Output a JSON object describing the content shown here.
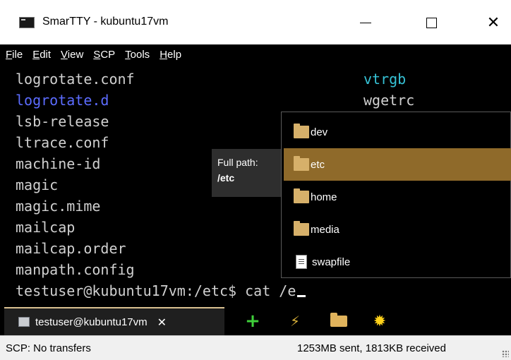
{
  "window": {
    "title": "SmarTTY - kubuntu17vm",
    "close_glyph": "✕"
  },
  "menu": [
    {
      "label": "File",
      "u": "F",
      "rest": "ile"
    },
    {
      "label": "Edit",
      "u": "E",
      "rest": "dit"
    },
    {
      "label": "View",
      "u": "V",
      "rest": "iew"
    },
    {
      "label": "SCP",
      "u": "S",
      "rest": "CP"
    },
    {
      "label": "Tools",
      "u": "T",
      "rest": "ools"
    },
    {
      "label": "Help",
      "u": "H",
      "rest": "elp"
    }
  ],
  "terminal": {
    "col1": [
      {
        "text": "logrotate.conf",
        "style": "normal"
      },
      {
        "text": "logrotate.d",
        "style": "blue"
      },
      {
        "text": "lsb-release",
        "style": "normal"
      },
      {
        "text": "ltrace.conf",
        "style": "normal"
      },
      {
        "text": "machine-id",
        "style": "normal"
      },
      {
        "text": "magic",
        "style": "normal"
      },
      {
        "text": "magic.mime",
        "style": "normal"
      },
      {
        "text": "mailcap",
        "style": "normal"
      },
      {
        "text": "mailcap.order",
        "style": "normal"
      },
      {
        "text": "manpath.config",
        "style": "normal"
      }
    ],
    "col2": [
      {
        "text": "vtrgb",
        "style": "cyan"
      },
      {
        "text": "wgetrc",
        "style": "normal"
      }
    ],
    "prompt": "testuser@kubuntu17vm:/etc$ cat /e"
  },
  "popup": {
    "items": [
      {
        "name": "dev",
        "type": "folder",
        "selected": false
      },
      {
        "name": "etc",
        "type": "folder",
        "selected": true
      },
      {
        "name": "home",
        "type": "folder",
        "selected": false
      },
      {
        "name": "media",
        "type": "folder",
        "selected": false
      },
      {
        "name": "swapfile",
        "type": "file",
        "selected": false
      }
    ],
    "selected_color": "#8f6a2a"
  },
  "tooltip": {
    "label": "Full path:",
    "value": "/etc"
  },
  "tabbar": {
    "tab_label": "testuser@kubuntu17vm",
    "close_glyph": "✕",
    "add_glyph": "+",
    "flash_glyph": "⚡",
    "sun_glyph": "✹"
  },
  "status": {
    "left": "SCP: No transfers",
    "right": "1253MB sent, 1813KB received"
  }
}
